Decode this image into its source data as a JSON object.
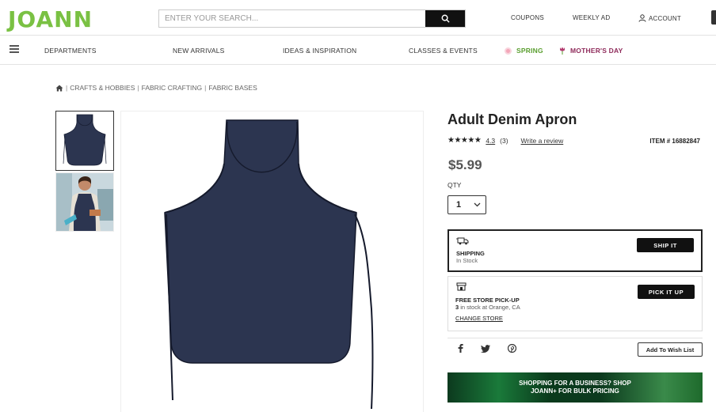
{
  "header": {
    "logo": "JOANN",
    "search_placeholder": "ENTER YOUR SEARCH...",
    "links": {
      "coupons": "COUPONS",
      "weekly_ad": "WEEKLY AD",
      "account": "ACCOUNT"
    }
  },
  "nav": {
    "items": [
      "DEPARTMENTS",
      "NEW ARRIVALS",
      "IDEAS & INSPIRATION",
      "CLASSES & EVENTS"
    ],
    "spring": "SPRING",
    "mothers_day": "MOTHER'S DAY"
  },
  "breadcrumb": [
    "CRAFTS & HOBBIES",
    "FABRIC CRAFTING",
    "FABRIC BASES"
  ],
  "product": {
    "title": "Adult Denim Apron",
    "stars": "★★★★★",
    "rating": "4.3",
    "review_count": "(3)",
    "write_review": "Write a review",
    "item_number": "ITEM # 16882847",
    "price": "$5.99",
    "qty_label": "QTY",
    "qty_value": "1"
  },
  "shipping": {
    "label": "SHIPPING",
    "status": "In Stock",
    "button": "SHIP IT"
  },
  "pickup": {
    "label": "FREE STORE PICK-UP",
    "count": "3",
    "status": "in stock at Orange, CA",
    "change_store": "CHANGE STORE",
    "button": "PICK IT UP"
  },
  "social": {
    "facebook": "f",
    "twitter": "t",
    "pinterest": "p"
  },
  "wishlist": "Add To Wish List",
  "banner": {
    "line1": "SHOPPING FOR A BUSINESS? SHOP",
    "line2": "JOANN+ FOR BULK PRICING"
  },
  "colors": {
    "brand_green": "#7ac143",
    "denim": "#2c3550",
    "spring": "#5a9e2f",
    "mothers_day": "#8e2a5a"
  },
  "icons": [
    "search-icon",
    "account-icon",
    "hamburger-icon",
    "home-icon",
    "truck-icon",
    "store-icon",
    "chevron-down-icon",
    "facebook-icon",
    "twitter-icon",
    "pinterest-icon"
  ]
}
